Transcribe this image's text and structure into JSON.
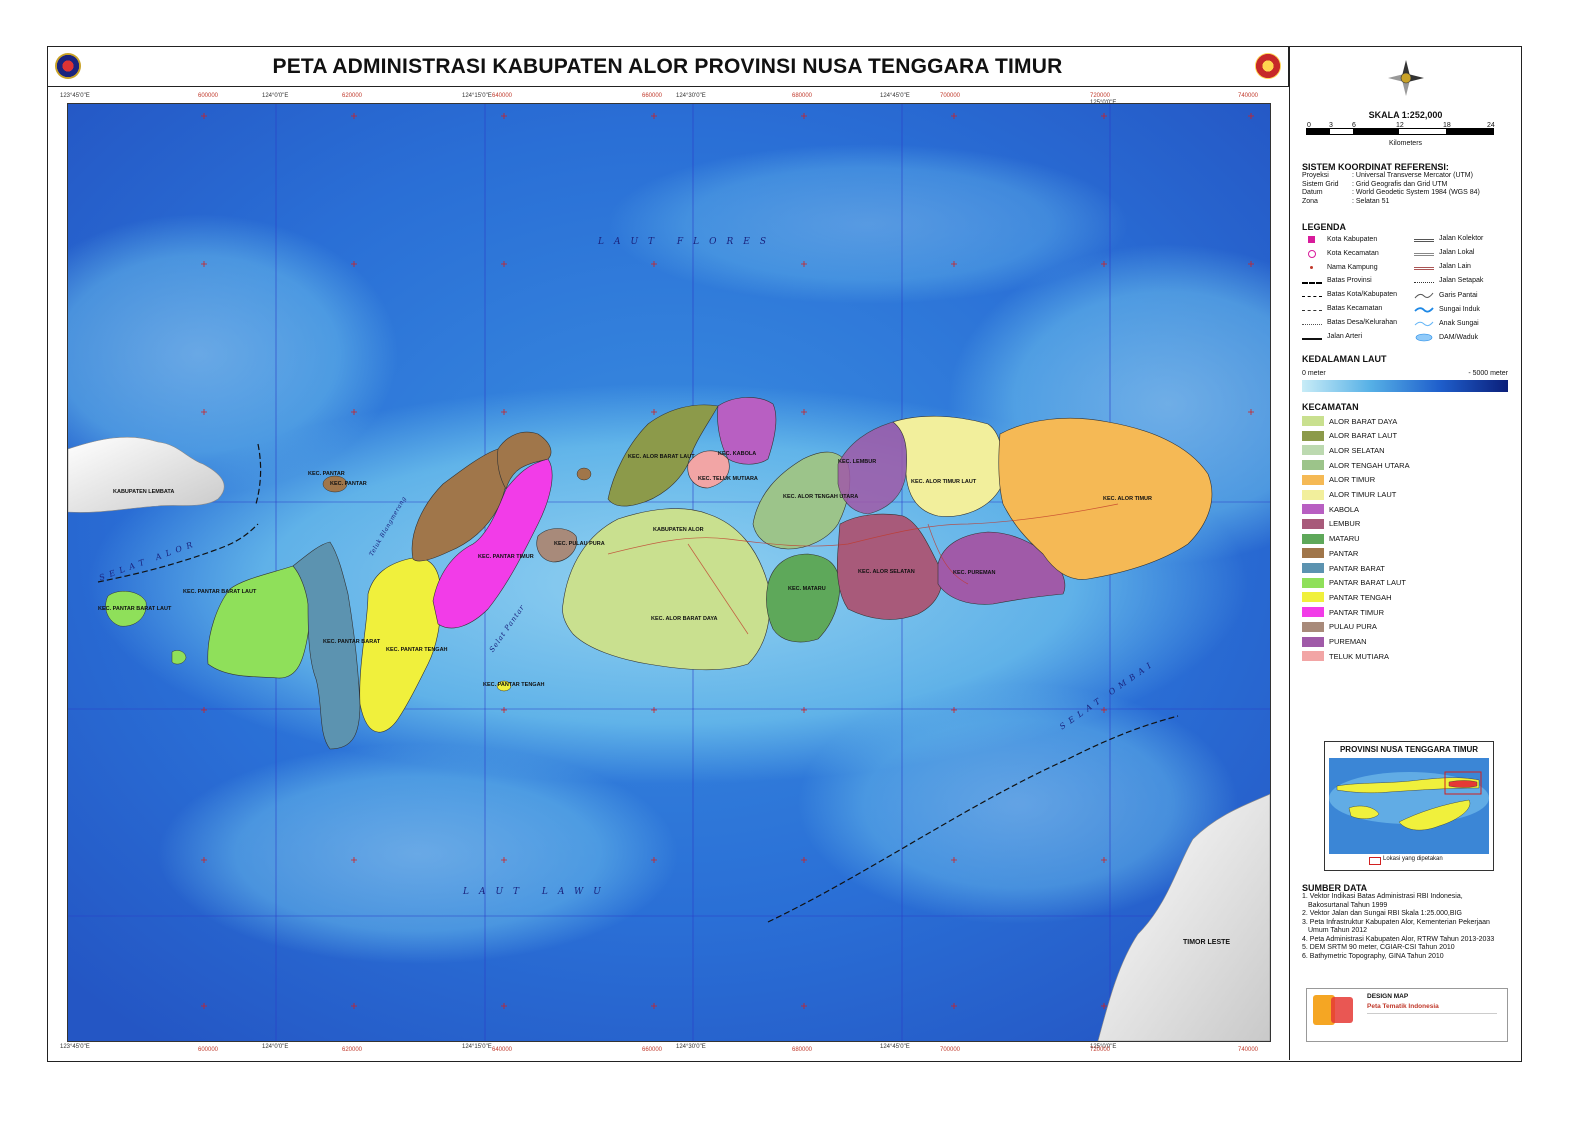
{
  "title": "PETA ADMINISTRASI KABUPATEN ALOR PROVINSI NUSA TENGGARA TIMUR",
  "scale": {
    "title": "SKALA 1:252,000",
    "ticks": [
      "0",
      "3",
      "6",
      "12",
      "18",
      "24"
    ],
    "unit": "Kilometers"
  },
  "coord_system": {
    "title": "SISTEM KOORDINAT REFERENSI:",
    "rows": [
      {
        "k": "Proyeksi",
        "v": ": Universal Transverse Mercator (UTM)"
      },
      {
        "k": "Sistem Grid",
        "v": ": Grid Geografis dan Grid UTM"
      },
      {
        "k": "Datum",
        "v": ": World Geodetic System 1984 (WGS 84)"
      },
      {
        "k": "Zona",
        "v": ": Selatan 51"
      }
    ]
  },
  "legend": {
    "title": "LEGENDA",
    "left": [
      "Kota Kabupaten",
      "Kota Kecamatan",
      "Nama Kampung",
      "Batas Provinsi",
      "Batas Kota/Kabupaten",
      "Batas Kecamatan",
      "Batas Desa/Kelurahan",
      "Jalan Arteri"
    ],
    "right": [
      "Jalan Kolektor",
      "Jalan Lokal",
      "Jalan Lain",
      "Jalan Setapak",
      "Garis Pantai",
      "Sungai Induk",
      "Anak Sungai",
      "DAM/Waduk"
    ]
  },
  "depth": {
    "title": "KEDALAMAN LAUT",
    "min_label": "0 meter",
    "max_label": "- 5000 meter"
  },
  "kecamatan": {
    "title": "KECAMATAN",
    "items": [
      {
        "name": "ALOR BARAT DAYA",
        "color": "#c9e08f"
      },
      {
        "name": "ALOR BARAT LAUT",
        "color": "#8c9a4a"
      },
      {
        "name": "ALOR SELATAN",
        "color": "#bcd9b0"
      },
      {
        "name": "ALOR TENGAH UTARA",
        "color": "#9cc48a"
      },
      {
        "name": "ALOR TIMUR",
        "color": "#f5b955"
      },
      {
        "name": "ALOR TIMUR LAUT",
        "color": "#f2ef9c"
      },
      {
        "name": "KABOLA",
        "color": "#b85fc2"
      },
      {
        "name": "LEMBUR",
        "color": "#a85a7a"
      },
      {
        "name": "MATARU",
        "color": "#5ea85a"
      },
      {
        "name": "PANTAR",
        "color": "#a0764a"
      },
      {
        "name": "PANTAR BARAT",
        "color": "#5c93b0"
      },
      {
        "name": "PANTAR BARAT LAUT",
        "color": "#8fe05a"
      },
      {
        "name": "PANTAR TENGAH",
        "color": "#f0f03c"
      },
      {
        "name": "PANTAR TIMUR",
        "color": "#f23ce8"
      },
      {
        "name": "PULAU PURA",
        "color": "#a88a7a"
      },
      {
        "name": "PUREMAN",
        "color": "#a05aa8"
      },
      {
        "name": "TELUK MUTIARA",
        "color": "#f2a5a5"
      }
    ]
  },
  "inset": {
    "title": "PROVINSI NUSA TENGGARA TIMUR",
    "note": "Lokasi yang dipetakan"
  },
  "sources": {
    "title": "SUMBER DATA",
    "items": [
      "1. Vektor Indikasi Batas Administrasi RBI Indonesia,",
      "    Bakosurtanal Tahun 1999",
      "2. Vektor Jalan dan Sungai RBI Skala 1:25.000,BIG",
      "3. Peta Infrastruktur Kabupaten Alor, Kementerian Pekerjaan",
      "    Umum Tahun 2012",
      "4. Peta Administrasi Kabupaten Alor, RTRW Tahun 2013-2033",
      "5. DEM SRTM 90 meter, CGIAR-CSI Tahun 2010",
      "6. Bathymetric Topography, GINA Tahun 2010"
    ]
  },
  "design": {
    "title": "DESIGN MAP",
    "subtitle": "Peta Tematik Indonesia"
  },
  "map": {
    "seas": {
      "flores": "LAUT FLORES",
      "lawu": "LAUT LAWU",
      "ombai": "SELAT OMBAI",
      "alor_strait": "SELAT ALOR",
      "pantar_strait": "Selat Pantar",
      "teluk": "Teluk Blangmerang"
    },
    "regions": {
      "lembata": "KABUPATEN LEMBATA",
      "timor": "TIMOR LESTE"
    },
    "kec_labels": [
      "KEC. PANTAR BARAT LAUT",
      "KEC. PANTAR BARAT LAUT",
      "KEC. PANTAR BARAT",
      "KEC. PANTAR TENGAH",
      "KEC. PANTAR",
      "KEC. PANTAR TIMUR",
      "KEC. PULAU PURA",
      "KEC. ALOR BARAT DAYA",
      "KEC. ALOR SELATAN",
      "KEC. ALOR TENGAH UTARA",
      "KEC. ALOR TIMUR LAUT",
      "KEC. ALOR TIMUR",
      "KEC. PUREMAN",
      "KEC. MATARU",
      "KEC. KABOLA",
      "KEC. TELUK MUTIARA",
      "KEC. LEMBUR",
      "KEC. ALOR BARAT LAUT",
      "KEC. PANTAR TENGAH",
      "KEC. PANTAR",
      "KABUPATEN ALOR"
    ],
    "lon_labels": [
      "123°45'0\"E",
      "124°0'0\"E",
      "124°15'0\"E",
      "124°30'0\"E",
      "124°45'0\"E",
      "125°0'0\"E"
    ],
    "utm_x_labels": [
      "600000",
      "620000",
      "640000",
      "660000",
      "680000",
      "700000",
      "720000",
      "740000"
    ]
  },
  "colors": {
    "sea_light": "#8fd1f0",
    "sea_mid": "#3a8ee0",
    "sea_deep": "#1a4fbf",
    "grid": "#2a3cc7",
    "cross": "#d12020"
  }
}
